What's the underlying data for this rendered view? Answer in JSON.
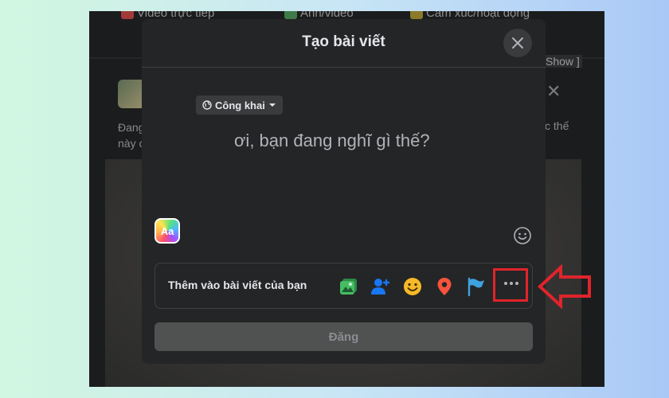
{
  "background_page": {
    "top_links": [
      "Video trực tiếp",
      "Ảnh/video",
      "Cảm xúc/hoạt động"
    ],
    "left_text_lines": [
      "Đang",
      "này c"
    ],
    "show_label": "Show ]",
    "right_text": "c thế"
  },
  "modal": {
    "title": "Tạo bài viết",
    "privacy_label": "Công khai",
    "prompt": "ơi, bạn đang nghĩ gì thế?",
    "text_style_label": "Aa",
    "add_to_post_label": "Thêm vào bài viết của bạn",
    "post_button_label": "Đăng",
    "add_icons": [
      "photo-video-icon",
      "tag-people-icon",
      "feeling-icon",
      "location-icon",
      "flag-icon",
      "more-icon"
    ]
  },
  "colors": {
    "modal_bg": "#242526",
    "highlight": "#e0242b",
    "photo_green": "#45bd62",
    "tag_blue": "#1877f2",
    "feeling_yellow": "#f7b928",
    "location_red": "#f5533d",
    "flag_blue": "#3ea2e0"
  }
}
